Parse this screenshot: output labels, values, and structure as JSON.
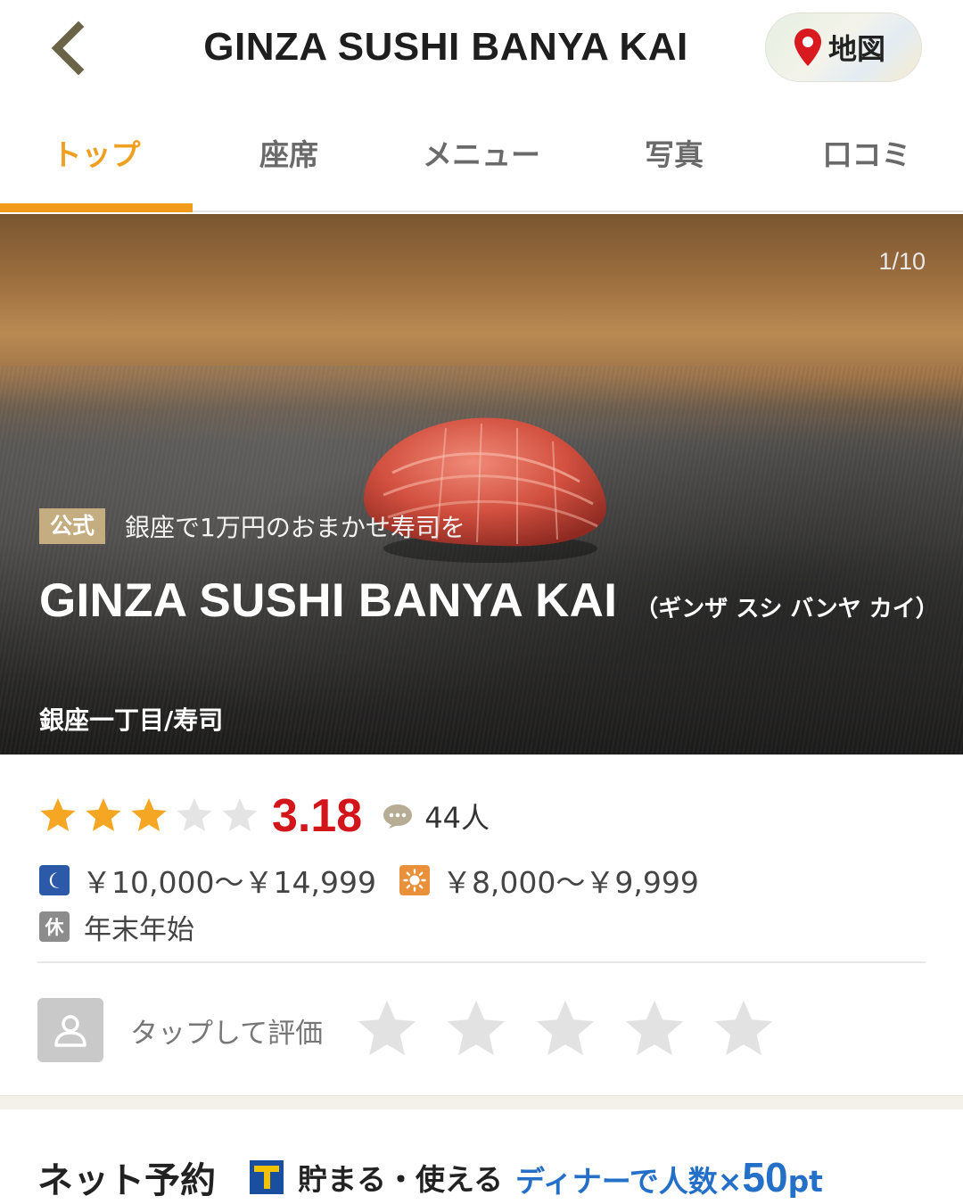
{
  "header": {
    "title": "GINZA SUSHI BANYA KAI",
    "map_label": "地図"
  },
  "tabs": [
    {
      "label": "トップ",
      "active": true
    },
    {
      "label": "座席",
      "active": false
    },
    {
      "label": "メニュー",
      "active": false
    },
    {
      "label": "写真",
      "active": false
    },
    {
      "label": "口コミ",
      "active": false
    }
  ],
  "hero": {
    "counter": "1/10",
    "official_badge": "公式",
    "catchphrase": "銀座で1万円のおまかせ寿司を",
    "name_en": "GINZA SUSHI BANYA KAI",
    "name_kana": "（ギンザ スシ バンヤ カイ）",
    "area_genre": "銀座一丁目/寿司"
  },
  "rating": {
    "stars_filled": 3,
    "stars_total": 5,
    "score": "3.18",
    "review_count": "44人"
  },
  "prices": {
    "dinner": "￥10,000～￥14,999",
    "lunch": "￥8,000～￥9,999"
  },
  "holiday": {
    "icon_label": "休",
    "text": "年末年始"
  },
  "user_rating": {
    "prompt": "タップして評価"
  },
  "booking": {
    "title": "ネット予約",
    "tpoint_label": "貯まる・使える",
    "promo_prefix": "ディナーで人数×",
    "promo_number": "50",
    "promo_suffix": "pt"
  },
  "colors": {
    "accent_orange": "#f29a1a",
    "score_red": "#d2151b",
    "star_gold": "#f5a623",
    "promo_blue": "#2470c8",
    "badge_tan": "#c4ad80"
  },
  "icons": {
    "back": "chevron-left-icon",
    "map_pin": "map-pin-icon",
    "review": "speech-bubble-icon",
    "dinner": "moon-icon",
    "lunch": "sun-icon",
    "avatar": "user-icon",
    "tpoint": "tpoint-logo-icon"
  }
}
